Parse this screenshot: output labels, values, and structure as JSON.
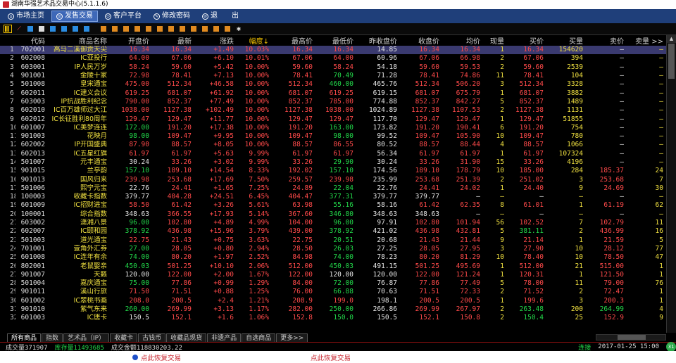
{
  "window": {
    "title": "湖南华强艺术品交易中心(5.1.1.6)"
  },
  "menu": [
    {
      "label": "市场主页",
      "active": false
    },
    {
      "label": "发售交易",
      "active": true
    },
    {
      "label": "客户平台",
      "active": false
    },
    {
      "label": "修改密码",
      "active": false
    },
    {
      "label": "退　　出",
      "active": false
    }
  ],
  "columns": [
    "",
    "代码",
    "商品名称",
    "开盘价",
    "最新",
    "涨跌",
    "幅度↓",
    "最高价",
    "最低价",
    "昨收盘价",
    "收盘价",
    "均价",
    "现量",
    "买价",
    "买量",
    "卖价",
    "卖量 >>"
  ],
  "rows": [
    [
      "1",
      "702001",
      "高马二溪御贡天尖",
      "16.34",
      "16.34",
      "+1.49",
      "10.03%",
      "16.34",
      "16.34",
      "14.85",
      "16.34",
      "16.34",
      "1",
      "16.34",
      "154620",
      "—",
      "—"
    ],
    [
      "2",
      "602008",
      "IC亚投行",
      "64.00",
      "67.06",
      "+6.10",
      "10.01%",
      "67.06",
      "64.00",
      "60.96",
      "67.06",
      "66.98",
      "2",
      "67.06",
      "394",
      "—",
      "—"
    ],
    [
      "3",
      "603001",
      "IP人民万岁",
      "58.24",
      "59.60",
      "+5.42",
      "10.00%",
      "59.60",
      "58.24",
      "54.18",
      "59.60",
      "59.53",
      "2",
      "59.60",
      "2539",
      "—",
      "—"
    ],
    [
      "4",
      "901001",
      "金陵十家",
      "72.98",
      "78.41",
      "+7.13",
      "10.00%",
      "78.41",
      "70.49",
      "71.28",
      "78.41",
      "74.86",
      "11",
      "78.41",
      "104",
      "—",
      "—"
    ],
    [
      "5",
      "501008",
      "皇宋通宝",
      "475.00",
      "512.34",
      "+46.58",
      "10.00%",
      "512.34",
      "460.00",
      "465.76",
      "512.34",
      "506.20",
      "3",
      "512.34",
      "3328",
      "—",
      "—"
    ],
    [
      "6",
      "602011",
      "IC建义会议",
      "619.25",
      "681.07",
      "+61.92",
      "10.00%",
      "681.07",
      "619.25",
      "619.15",
      "681.07",
      "675.79",
      "1",
      "681.07",
      "3882",
      "—",
      "—"
    ],
    [
      "7",
      "603003",
      "IP抗战胜利纪念",
      "790.00",
      "852.37",
      "+77.49",
      "10.00%",
      "852.37",
      "785.00",
      "774.88",
      "852.37",
      "842.27",
      "5",
      "852.37",
      "1489",
      "—",
      "—"
    ],
    [
      "8",
      "602010",
      "IC百万雄师过大江",
      "1038.00",
      "1127.38",
      "+102.49",
      "10.00%",
      "1127.38",
      "1038.00",
      "1024.89",
      "1127.38",
      "1107.53",
      "2",
      "1127.38",
      "1131",
      "—",
      "—"
    ],
    [
      "9",
      "602012",
      "IC长征胜利80周年",
      "129.47",
      "129.47",
      "+11.77",
      "10.00%",
      "129.47",
      "129.47",
      "117.70",
      "129.47",
      "129.47",
      "1",
      "129.47",
      "51855",
      "—",
      "—"
    ],
    [
      "10",
      "601007",
      "IC美梦连连",
      "172.00",
      "191.20",
      "+17.38",
      "10.00%",
      "191.20",
      "163.00",
      "173.82",
      "191.20",
      "190.41",
      "6",
      "191.20",
      "754",
      "—",
      "—"
    ],
    [
      "11",
      "901003",
      "花映月",
      "98.00",
      "109.47",
      "+9.95",
      "10.00%",
      "109.47",
      "98.00",
      "99.52",
      "109.47",
      "105.90",
      "10",
      "109.47",
      "780",
      "—",
      "—"
    ],
    [
      "12",
      "602002",
      "IP开国盛典",
      "87.90",
      "88.57",
      "+8.05",
      "10.00%",
      "88.57",
      "86.55",
      "80.52",
      "88.57",
      "88.44",
      "4",
      "88.57",
      "1066",
      "—",
      "—"
    ],
    [
      "13",
      "602013",
      "IC五星红旗",
      "61.97",
      "61.97",
      "+5.63",
      "9.99%",
      "61.97",
      "61.97",
      "56.34",
      "61.97",
      "61.97",
      "1",
      "61.97",
      "107324",
      "—",
      "—"
    ],
    [
      "14",
      "501007",
      "元丰通宝",
      "30.24",
      "33.26",
      "+3.02",
      "9.99%",
      "33.26",
      "29.90",
      "30.24",
      "33.26",
      "31.90",
      "15",
      "33.26",
      "4196",
      "—",
      "—"
    ],
    [
      "15",
      "901015",
      "兰亭韵",
      "157.10",
      "189.10",
      "+14.54",
      "8.33%",
      "192.02",
      "157.10",
      "174.56",
      "189.10",
      "178.79",
      "10",
      "185.00",
      "284",
      "185.37",
      "24"
    ],
    [
      "16",
      "901013",
      "国风归来",
      "239.98",
      "253.68",
      "+17.69",
      "7.50%",
      "259.57",
      "239.98",
      "235.99",
      "253.68",
      "251.39",
      "2",
      "251.02",
      "3",
      "253.68",
      "7"
    ],
    [
      "17",
      "501006",
      "熙宁元宝",
      "22.76",
      "24.41",
      "+1.65",
      "7.25%",
      "24.89",
      "22.04",
      "22.76",
      "24.41",
      "24.02",
      "1",
      "24.40",
      "9",
      "24.69",
      "30"
    ],
    [
      "18",
      "100003",
      "收藏卡指数",
      "379.77",
      "404.28",
      "+24.51",
      "6.45%",
      "404.47",
      "377.31",
      "379.77",
      "379.77",
      "—",
      "—",
      "—",
      "—",
      "—",
      "—"
    ],
    [
      "19",
      "601009",
      "IC招财进宝",
      "58.50",
      "61.42",
      "+3.26",
      "5.61%",
      "63.98",
      "55.16",
      "58.16",
      "61.42",
      "62.35",
      "8",
      "61.01",
      "1",
      "61.19",
      "62"
    ],
    [
      "20",
      "100001",
      "综合指数",
      "348.63",
      "366.55",
      "+17.93",
      "5.14%",
      "367.60",
      "346.80",
      "348.63",
      "348.63",
      "—",
      "—",
      "—",
      "—",
      "—",
      "—"
    ],
    [
      "21",
      "603002",
      "潇湘八景",
      "96.00",
      "102.80",
      "+4.89",
      "4.99%",
      "104.00",
      "96.00",
      "97.91",
      "102.80",
      "101.94",
      "56",
      "102.52",
      "7",
      "102.79",
      "11"
    ],
    [
      "22",
      "602007",
      "IC颐和园",
      "378.92",
      "436.98",
      "+15.96",
      "3.79%",
      "439.00",
      "378.92",
      "421.02",
      "436.98",
      "432.81",
      "5",
      "381.11",
      "2",
      "436.99",
      "16"
    ],
    [
      "23",
      "501003",
      "道光通宝",
      "22.75",
      "21.43",
      "+0.75",
      "3.63%",
      "22.75",
      "20.51",
      "20.68",
      "21.43",
      "21.44",
      "9",
      "21.14",
      "1",
      "21.59",
      "5"
    ],
    [
      "24",
      "701001",
      "壹角外汇券",
      "27.00",
      "28.05",
      "+0.80",
      "2.94%",
      "28.50",
      "26.03",
      "27.25",
      "28.05",
      "27.95",
      "3",
      "27.90",
      "10",
      "28.12",
      "77"
    ],
    [
      "25",
      "601008",
      "IC连年有余",
      "74.00",
      "80.20",
      "+1.97",
      "2.52%",
      "84.98",
      "74.00",
      "78.23",
      "80.20",
      "81.29",
      "10",
      "78.40",
      "10",
      "78.50",
      "47"
    ],
    [
      "26",
      "802001",
      "老鼠娶亲",
      "450.03",
      "501.25",
      "+10.10",
      "2.06%",
      "512.00",
      "450.03",
      "491.15",
      "501.25",
      "495.69",
      "1",
      "512.00",
      "21",
      "515.00",
      "1"
    ],
    [
      "27",
      "901007",
      "天籁",
      "120.00",
      "122.00",
      "+2.00",
      "1.67%",
      "122.00",
      "120.00",
      "120.00",
      "122.00",
      "121.24",
      "1",
      "120.31",
      "1",
      "121.50",
      "1"
    ],
    [
      "28",
      "501004",
      "嘉庆通宝",
      "75.00",
      "77.86",
      "+0.99",
      "1.29%",
      "84.00",
      "72.00",
      "76.87",
      "77.86",
      "77.49",
      "5",
      "78.00",
      "11",
      "79.00",
      "76"
    ],
    [
      "29",
      "901011",
      "溪山行旅",
      "71.50",
      "71.51",
      "+0.88",
      "1.25%",
      "76.00",
      "66.88",
      "70.63",
      "71.51",
      "72.33",
      "2",
      "71.52",
      "2",
      "72.47",
      "1"
    ],
    [
      "30",
      "601002",
      "IC翠桃书画",
      "208.0",
      "200.5",
      "+2.4",
      "1.21%",
      "208.9",
      "199.0",
      "198.1",
      "200.5",
      "200.5",
      "1",
      "199.6",
      "3",
      "200.3",
      "1"
    ],
    [
      "31",
      "901010",
      "紫气东来",
      "260.00",
      "269.99",
      "+3.13",
      "1.17%",
      "282.00",
      "250.00",
      "266.86",
      "269.99",
      "267.97",
      "2",
      "263.48",
      "200",
      "264.99",
      "4"
    ],
    [
      "32",
      "601003",
      "IC唐卡",
      "150.5",
      "152.1",
      "+1.6",
      "1.06%",
      "152.8",
      "150.0",
      "150.5",
      "152.1",
      "150.8",
      "2",
      "150.4",
      "25",
      "152.9",
      "9"
    ]
  ],
  "tabs": [
    {
      "label": "所有商品",
      "active": true
    },
    {
      "label": "指数",
      "active": false
    },
    {
      "label": "艺术品（IP）",
      "active": false
    },
    {
      "label": "收藏卡",
      "active": false
    },
    {
      "label": "古钱币",
      "active": false
    },
    {
      "label": "收藏品现货",
      "active": false
    },
    {
      "label": "非遗产品",
      "active": false
    },
    {
      "label": "自选商品",
      "active": false
    },
    {
      "label": "更多>>",
      "active": false
    }
  ],
  "status": {
    "volume_text": "成交量371907",
    "stock_text": "库存量11493685",
    "amount_text": "成交金额118830203.22",
    "connection": "连接",
    "datetime": "2017-01-25 15:00",
    "badge": "31"
  },
  "notice": {
    "left": "点此恢复交易",
    "right": "点此恢复交易"
  },
  "colors": {
    "up": "#ff4a4a",
    "down": "#22d84a",
    "name": "#f0e040",
    "menu_bg": "#1f3f7a",
    "selected_row": "#3a3a70"
  }
}
